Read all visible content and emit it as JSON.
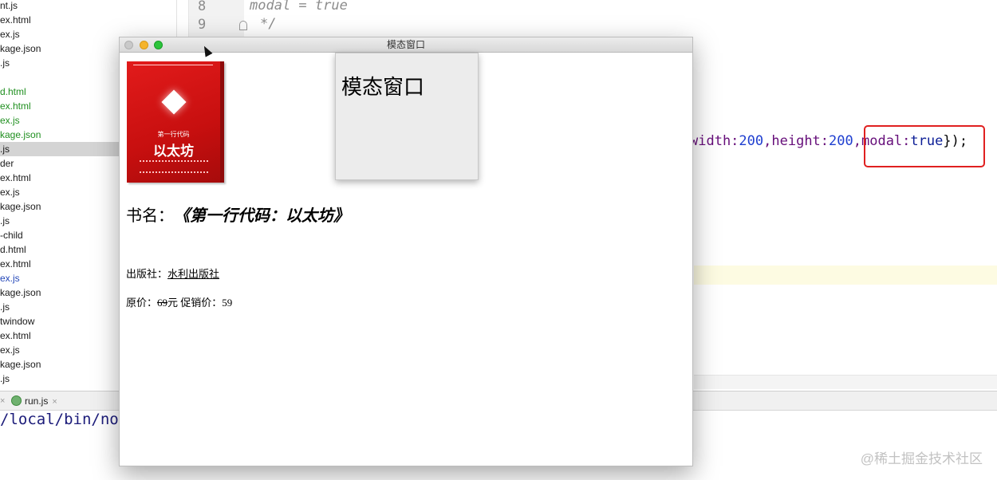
{
  "ide": {
    "file_tree": [
      {
        "label": "nt.js",
        "color": "normal"
      },
      {
        "label": "ex.html",
        "color": "normal"
      },
      {
        "label": "ex.js",
        "color": "normal"
      },
      {
        "label": "kage.json",
        "color": "normal"
      },
      {
        "label": ".js",
        "color": "normal"
      },
      {
        "label": "",
        "color": "normal"
      },
      {
        "label": "d.html",
        "color": "green"
      },
      {
        "label": "ex.html",
        "color": "green"
      },
      {
        "label": "ex.js",
        "color": "green"
      },
      {
        "label": "kage.json",
        "color": "green"
      },
      {
        "label": ".js",
        "color": "selected"
      },
      {
        "label": "der",
        "color": "normal"
      },
      {
        "label": "ex.html",
        "color": "normal"
      },
      {
        "label": "ex.js",
        "color": "normal"
      },
      {
        "label": "kage.json",
        "color": "normal"
      },
      {
        "label": ".js",
        "color": "normal"
      },
      {
        "label": "-child",
        "color": "normal"
      },
      {
        "label": "d.html",
        "color": "normal"
      },
      {
        "label": "ex.html",
        "color": "normal"
      },
      {
        "label": "ex.js",
        "color": "blue"
      },
      {
        "label": "kage.json",
        "color": "normal"
      },
      {
        "label": ".js",
        "color": "normal"
      },
      {
        "label": "twindow",
        "color": "normal"
      },
      {
        "label": "ex.html",
        "color": "normal"
      },
      {
        "label": "ex.js",
        "color": "normal"
      },
      {
        "label": "kage.json",
        "color": "normal"
      },
      {
        "label": ".js",
        "color": "normal"
      }
    ],
    "line_numbers": [
      "8",
      "9"
    ],
    "code_line_8": "modal = true",
    "code_line_9": "*/",
    "code_visible_fragment": {
      "p1": "width:",
      "n1": "200",
      "p2": ",height:",
      "n2": "200",
      "p3": ",modal:",
      "p4": "true",
      "p5": "});"
    },
    "colors": {
      "keyword": "#0b1d96",
      "number": "#1f3fd0",
      "property": "#660e7a",
      "comment": "#8c8c8c",
      "highlight_box": "#e02020"
    },
    "run_tab": {
      "label": "run.js",
      "close": "×",
      "icon": "nodejs-icon"
    },
    "tab_close_left": "×",
    "console_output": "/local/bin/node",
    "watermark": "@稀土掘金技术社区"
  },
  "modal_window": {
    "title": "模态窗口",
    "traffic_lights": [
      "close-button",
      "minimize-button",
      "maximize-button"
    ],
    "cover": {
      "subtitle": "第一行代码",
      "title": "以太坊"
    },
    "child_modal": {
      "heading": "模态窗口"
    },
    "book_name_label": "书名：",
    "book_name_value": "《第一行代码：以太坊》",
    "publisher_label": "出版社：",
    "publisher_value": "水利出版社",
    "price_label": "原价：",
    "original_price": "69",
    "price_unit": "元",
    "sale_label": "促销价：",
    "sale_price": "59"
  }
}
